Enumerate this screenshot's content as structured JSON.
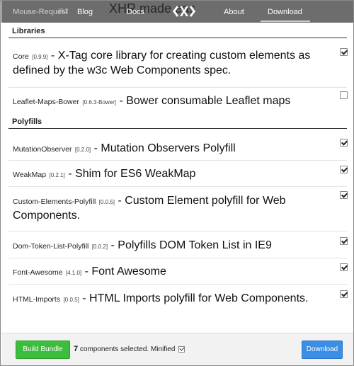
{
  "nav": {
    "ghost_left": "Mouse-Request",
    "ghost_version": "[0.2",
    "ghost_title": "XHR made eas",
    "blog": "Blog",
    "docs": "Docs",
    "about": "About",
    "download": "Download",
    "logo_icon": "x-tag-logo-icon"
  },
  "libraries": {
    "heading": "Libraries",
    "items": [
      {
        "name": "Core",
        "version": "[0.9.9]",
        "dash": "-",
        "description": "X-Tag core library for creating custom elements as defined by the w3c Web Components spec.",
        "checked": true
      },
      {
        "name": "Leaflet-Maps-Bower",
        "version": "[0.6.3-Bower]",
        "dash": "-",
        "description": "Bower consumable Leaflet maps",
        "checked": false
      }
    ]
  },
  "polyfills": {
    "heading": "Polyfills",
    "items": [
      {
        "name": "MutationObserver",
        "version": "[0.2.0]",
        "dash": "-",
        "description": "Mutation Observers Polyfill",
        "checked": true
      },
      {
        "name": "WeakMap",
        "version": "[0.2.1]",
        "dash": "-",
        "description": "Shim for ES6 WeakMap",
        "checked": true
      },
      {
        "name": "Custom-Elements-Polyfill",
        "version": "[0.0.5]",
        "dash": "-",
        "description": "Custom Element polyfill for Web Components.",
        "checked": true
      },
      {
        "name": "Dom-Token-List-Polyfill",
        "version": "[0.0.2]",
        "dash": "-",
        "description": "Polyfills DOM Token List in IE9",
        "checked": true
      },
      {
        "name": "Font-Awesome",
        "version": "[4.1.0]",
        "dash": "-",
        "description": "Font Awesome",
        "checked": true
      },
      {
        "name": "HTML-Imports",
        "version": "[0.0.5]",
        "dash": "-",
        "description": "HTML Imports polyfill for Web Components.",
        "checked": true
      }
    ]
  },
  "footer": {
    "build_label": "Build Bundle",
    "count": "7",
    "status_text": "components selected. Minified",
    "minified_checked": true,
    "download_label": "Download"
  },
  "colors": {
    "topbar": "#6d6d6d",
    "build_button": "#3dbd3d",
    "download_button": "#3a8ee6"
  }
}
